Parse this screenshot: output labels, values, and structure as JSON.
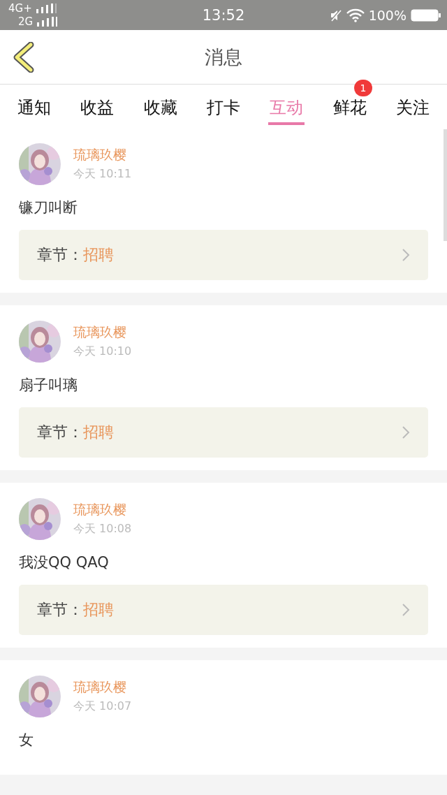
{
  "status_bar": {
    "network_1": "4G+",
    "network_2": "2G",
    "time": "13:52",
    "battery": "100%"
  },
  "header": {
    "title": "消息"
  },
  "tabs": [
    {
      "label": "通知",
      "selected": false
    },
    {
      "label": "收益",
      "selected": false
    },
    {
      "label": "收藏",
      "selected": false
    },
    {
      "label": "打卡",
      "selected": false
    },
    {
      "label": "互动",
      "selected": true
    },
    {
      "label": "鲜花",
      "selected": false,
      "badge": "1"
    },
    {
      "label": "关注",
      "selected": false
    }
  ],
  "messages": [
    {
      "user": "琉璃玖樱",
      "time": "今天 10:11",
      "text": "镰刀叫断",
      "chapter_label": "章节：",
      "chapter": "招聘"
    },
    {
      "user": "琉璃玖樱",
      "time": "今天 10:10",
      "text": "扇子叫璃",
      "chapter_label": "章节：",
      "chapter": "招聘"
    },
    {
      "user": "琉璃玖樱",
      "time": "今天 10:08",
      "text": "我没QQ QAQ",
      "chapter_label": "章节：",
      "chapter": "招聘"
    },
    {
      "user": "琉璃玖樱",
      "time": "今天 10:07",
      "text": "女"
    }
  ]
}
